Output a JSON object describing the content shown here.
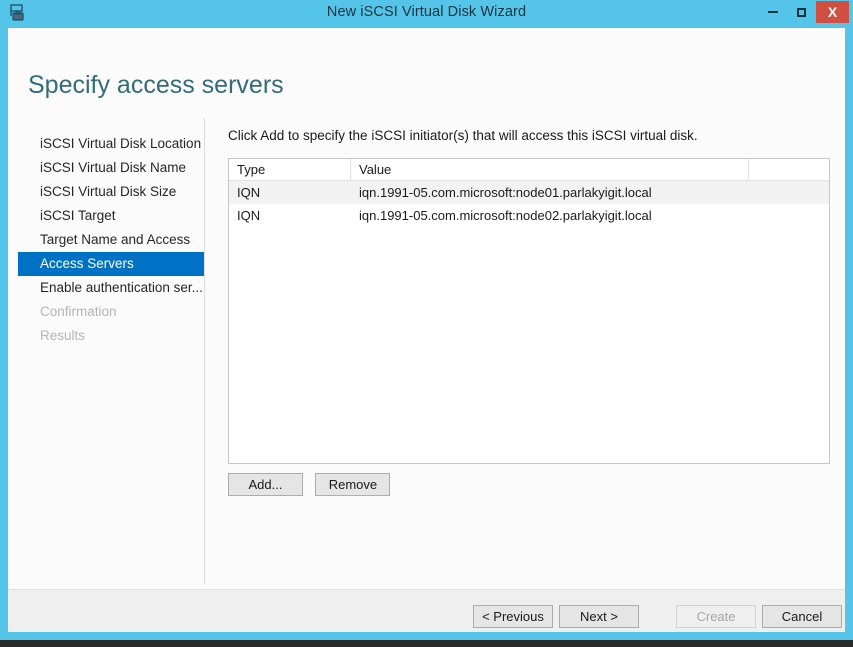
{
  "window": {
    "title": "New iSCSI Virtual Disk Wizard",
    "icon": "iscsi-disk-icon",
    "controls": {
      "minimize": "minimize-icon",
      "maximize": "maximize-icon",
      "close": "X"
    },
    "colors": {
      "titlebar": "#54c5e8",
      "close_button": "#cf4f43",
      "accent_selected": "#0072c6",
      "heading": "#336b79"
    }
  },
  "page": {
    "title": "Specify access servers"
  },
  "sidebar": {
    "items": [
      {
        "label": "iSCSI Virtual Disk Location",
        "state": "normal"
      },
      {
        "label": "iSCSI Virtual Disk Name",
        "state": "normal"
      },
      {
        "label": "iSCSI Virtual Disk Size",
        "state": "normal"
      },
      {
        "label": "iSCSI Target",
        "state": "normal"
      },
      {
        "label": "Target Name and Access",
        "state": "normal"
      },
      {
        "label": "Access Servers",
        "state": "selected"
      },
      {
        "label": "Enable authentication ser...",
        "state": "normal"
      },
      {
        "label": "Confirmation",
        "state": "disabled"
      },
      {
        "label": "Results",
        "state": "disabled"
      }
    ]
  },
  "main": {
    "instruction": "Click Add to specify the iSCSI initiator(s) that will access this iSCSI virtual disk.",
    "grid": {
      "columns": [
        "Type",
        "Value",
        ""
      ],
      "rows": [
        {
          "type": "IQN",
          "value": "iqn.1991-05.com.microsoft:node01.parlakyigit.local"
        },
        {
          "type": "IQN",
          "value": "iqn.1991-05.com.microsoft:node02.parlakyigit.local"
        }
      ]
    },
    "buttons": {
      "add": "Add...",
      "remove": "Remove"
    }
  },
  "footer": {
    "previous": "< Previous",
    "next": "Next >",
    "create": "Create",
    "cancel": "Cancel"
  }
}
